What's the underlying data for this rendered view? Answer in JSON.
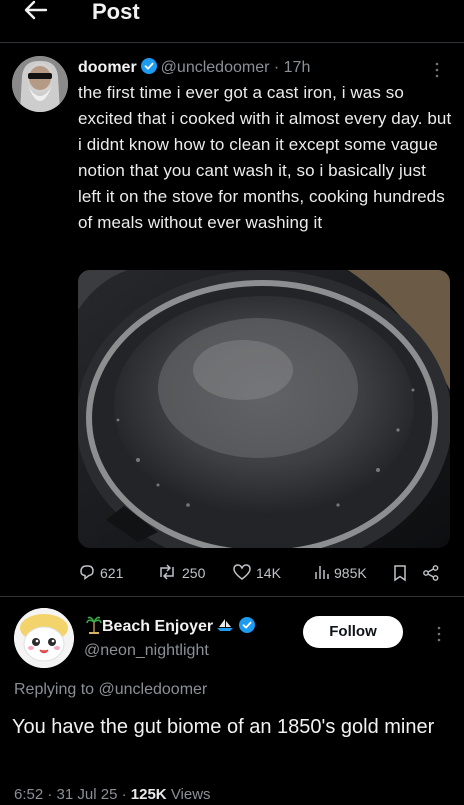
{
  "header": {
    "title": "Post",
    "back_icon": "arrow-left-icon"
  },
  "tweet": {
    "name": "doomer",
    "handle": "@uncledoomer",
    "separator": "·",
    "time": "17h",
    "text": "the first time i ever got a cast iron, i was so excited that i cooked with it almost every day. but i didnt know how to clean it except some vague notion that you cant wash it, so i basically just left it on the stove for months, cooking hundreds of meals without ever washing it",
    "stats": {
      "replies": "621",
      "reposts": "250",
      "likes": "14K",
      "views": "985K"
    }
  },
  "reply": {
    "name": "Beach Enjoyer",
    "handle": "@neon_nightlight",
    "follow_label": "Follow",
    "replying_prefix": "Replying to",
    "replying_to": "@uncledoomer",
    "text": "You have the gut biome of an 1850's gold miner",
    "footer_time": "6:52",
    "footer_date": "31 Jul 25",
    "footer_views_count": "125K",
    "footer_views_label": "Views"
  },
  "colors": {
    "background": "#000000",
    "text": "#e7e9ea",
    "muted": "#8b9096",
    "verified": "#1d9bf0",
    "follow_bg": "#ffffff"
  }
}
